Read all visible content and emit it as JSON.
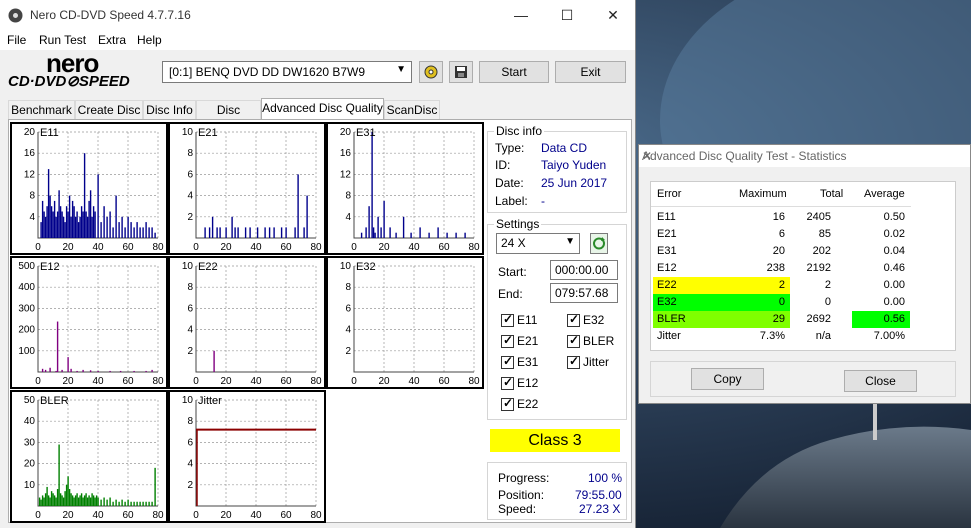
{
  "window": {
    "title": "Nero CD-DVD Speed 4.7.7.16",
    "minimize": "—",
    "maximize": "☐",
    "close": "✕"
  },
  "menu": [
    "File",
    "Run Test",
    "Extra",
    "Help"
  ],
  "logo": {
    "line1": "nero",
    "line2": "CD·DVD⊘SPEED"
  },
  "drive": {
    "selected": "[0:1]   BENQ DVD DD DW1620 B7W9"
  },
  "buttons": {
    "start": "Start",
    "exit": "Exit"
  },
  "tabs": [
    "Benchmark",
    "Create Disc",
    "Disc Info",
    "Disc Quality",
    "Advanced Disc Quality",
    "ScanDisc"
  ],
  "active_tab": "Advanced Disc Quality",
  "disc_info": {
    "title": "Disc info",
    "type_label": "Type:",
    "type": "Data CD",
    "id_label": "ID:",
    "id": "Taiyo Yuden",
    "date_label": "Date:",
    "date": "25 Jun 2017",
    "label_label": "Label:",
    "label": "-"
  },
  "settings": {
    "title": "Settings",
    "speed": "24 X",
    "start_label": "Start:",
    "start": "000:00.00",
    "end_label": "End:",
    "end": "079:57.68",
    "checks": [
      "E11",
      "E32",
      "E21",
      "BLER",
      "E31",
      "Jitter",
      "E12",
      "E22"
    ]
  },
  "class": "Class 3",
  "progress": {
    "progress_label": "Progress:",
    "progress": "100 %",
    "position_label": "Position:",
    "position": "79:55.00",
    "speed_label": "Speed:",
    "speed": "27.23 X"
  },
  "colors": {
    "bar_blue": "#00008b",
    "bar_purple": "#800080",
    "bar_green": "#008000",
    "jitter_red": "#8b0000"
  },
  "chart_data": [
    {
      "type": "bar",
      "title": "E11",
      "ylim": [
        0,
        20
      ],
      "yticks": [
        4,
        8,
        12,
        16,
        20
      ],
      "xticks": [
        0,
        20,
        40,
        60,
        80
      ],
      "color": "#00008b",
      "x": [
        2,
        3,
        4,
        5,
        6,
        7,
        8,
        9,
        10,
        11,
        12,
        13,
        14,
        15,
        16,
        17,
        18,
        19,
        20,
        21,
        22,
        23,
        24,
        25,
        26,
        27,
        28,
        29,
        30,
        31,
        32,
        33,
        34,
        35,
        36,
        37,
        38,
        40,
        42,
        44,
        46,
        48,
        50,
        52,
        54,
        56,
        58,
        60,
        62,
        64,
        66,
        68,
        70,
        72,
        74,
        76,
        78
      ],
      "values": [
        3,
        7,
        5,
        4,
        6,
        13,
        8,
        6,
        5,
        7,
        4,
        5,
        9,
        6,
        5,
        4,
        3,
        6,
        5,
        8,
        4,
        7,
        6,
        4,
        5,
        3,
        4,
        6,
        5,
        16,
        5,
        4,
        7,
        9,
        4,
        6,
        5,
        12,
        3,
        6,
        4,
        5,
        2,
        8,
        3,
        4,
        2,
        4,
        3,
        2,
        3,
        2,
        2,
        3,
        2,
        2,
        1
      ]
    },
    {
      "type": "bar",
      "title": "E21",
      "ylim": [
        0,
        10
      ],
      "yticks": [
        2,
        4,
        6,
        8,
        10
      ],
      "xticks": [
        0,
        20,
        40,
        60,
        80
      ],
      "color": "#00008b",
      "x": [
        6,
        9,
        11,
        14,
        16,
        20,
        24,
        26,
        28,
        33,
        36,
        41,
        46,
        49,
        52,
        57,
        60,
        66,
        68,
        72,
        74
      ],
      "values": [
        1,
        1,
        2,
        1,
        1,
        1,
        2,
        1,
        1,
        1,
        1,
        1,
        1,
        1,
        1,
        1,
        1,
        1,
        6,
        1,
        4
      ]
    },
    {
      "type": "bar",
      "title": "E31",
      "ylim": [
        0,
        20
      ],
      "yticks": [
        4,
        8,
        12,
        16,
        20
      ],
      "xticks": [
        0,
        20,
        40,
        60,
        80
      ],
      "color": "#00008b",
      "x": [
        5,
        8,
        10,
        12,
        13,
        14,
        16,
        18,
        20,
        24,
        28,
        33,
        38,
        44,
        50,
        56,
        62,
        68,
        74
      ],
      "values": [
        1,
        2,
        6,
        20,
        2,
        1,
        4,
        2,
        7,
        2,
        1,
        4,
        1,
        2,
        1,
        2,
        1,
        1,
        1
      ]
    },
    {
      "type": "bar",
      "title": "E12",
      "ylim": [
        0,
        500
      ],
      "yticks": [
        100,
        200,
        300,
        400,
        500
      ],
      "xticks": [
        0,
        20,
        40,
        60,
        80
      ],
      "color": "#800080",
      "x": [
        3,
        5,
        8,
        12,
        13,
        16,
        20,
        22,
        26,
        30,
        35,
        40,
        48,
        55,
        64,
        72,
        76
      ],
      "values": [
        15,
        10,
        20,
        5,
        238,
        10,
        70,
        15,
        5,
        10,
        8,
        5,
        5,
        5,
        5,
        5,
        10
      ]
    },
    {
      "type": "bar",
      "title": "E22",
      "ylim": [
        0,
        10
      ],
      "yticks": [
        2,
        4,
        6,
        8,
        10
      ],
      "xticks": [
        0,
        20,
        40,
        60,
        80
      ],
      "color": "#800080",
      "x": [
        12
      ],
      "values": [
        2
      ]
    },
    {
      "type": "bar",
      "title": "E32",
      "ylim": [
        0,
        10
      ],
      "yticks": [
        2,
        4,
        6,
        8,
        10
      ],
      "xticks": [
        0,
        20,
        40,
        60,
        80
      ],
      "color": "#800080",
      "x": [],
      "values": []
    },
    {
      "type": "bar",
      "title": "BLER",
      "ylim": [
        0,
        50
      ],
      "yticks": [
        10,
        20,
        30,
        40,
        50
      ],
      "xticks": [
        0,
        20,
        40,
        60,
        80
      ],
      "color": "#008000",
      "x": [
        1,
        2,
        3,
        4,
        5,
        6,
        7,
        8,
        9,
        10,
        11,
        12,
        13,
        14,
        15,
        16,
        17,
        18,
        19,
        20,
        21,
        22,
        23,
        24,
        25,
        26,
        27,
        28,
        29,
        30,
        31,
        32,
        33,
        34,
        35,
        36,
        37,
        38,
        39,
        40,
        42,
        44,
        46,
        48,
        50,
        52,
        54,
        56,
        58,
        60,
        62,
        64,
        66,
        68,
        70,
        72,
        74,
        76,
        78
      ],
      "values": [
        4,
        3,
        5,
        4,
        6,
        9,
        5,
        4,
        7,
        6,
        5,
        4,
        8,
        29,
        6,
        5,
        4,
        7,
        10,
        14,
        8,
        6,
        5,
        4,
        5,
        6,
        4,
        5,
        6,
        4,
        5,
        6,
        4,
        5,
        4,
        6,
        5,
        4,
        5,
        4,
        3,
        4,
        3,
        4,
        2,
        3,
        2,
        3,
        2,
        3,
        2,
        2,
        2,
        2,
        2,
        2,
        2,
        2,
        18
      ]
    },
    {
      "type": "line",
      "title": "Jitter",
      "ylim": [
        0,
        10
      ],
      "yticks": [
        2,
        4,
        6,
        8,
        10
      ],
      "xticks": [
        0,
        20,
        40,
        60,
        80
      ],
      "color": "#8b0000",
      "x": [
        0,
        80
      ],
      "values": [
        7.2,
        7.2
      ]
    }
  ],
  "stats": {
    "title": "Advanced Disc Quality Test - Statistics",
    "close": "✕",
    "headers": [
      "Error",
      "Maximum",
      "Total",
      "Average"
    ],
    "rows": [
      {
        "error": "E11",
        "maximum": "16",
        "total": "2405",
        "average": "0.50"
      },
      {
        "error": "E21",
        "maximum": "6",
        "total": "85",
        "average": "0.02"
      },
      {
        "error": "E31",
        "maximum": "20",
        "total": "202",
        "average": "0.04"
      },
      {
        "error": "E12",
        "maximum": "238",
        "total": "2192",
        "average": "0.46"
      },
      {
        "error": "E22",
        "maximum": "2",
        "total": "2",
        "average": "0.00"
      },
      {
        "error": "E32",
        "maximum": "0",
        "total": "0",
        "average": "0.00"
      },
      {
        "error": "BLER",
        "maximum": "29",
        "total": "2692",
        "average": "0.56"
      },
      {
        "error": "Jitter",
        "maximum": "7.3%",
        "total": "n/a",
        "average": "7.00%"
      }
    ],
    "copy": "Copy",
    "close_btn": "Close"
  }
}
